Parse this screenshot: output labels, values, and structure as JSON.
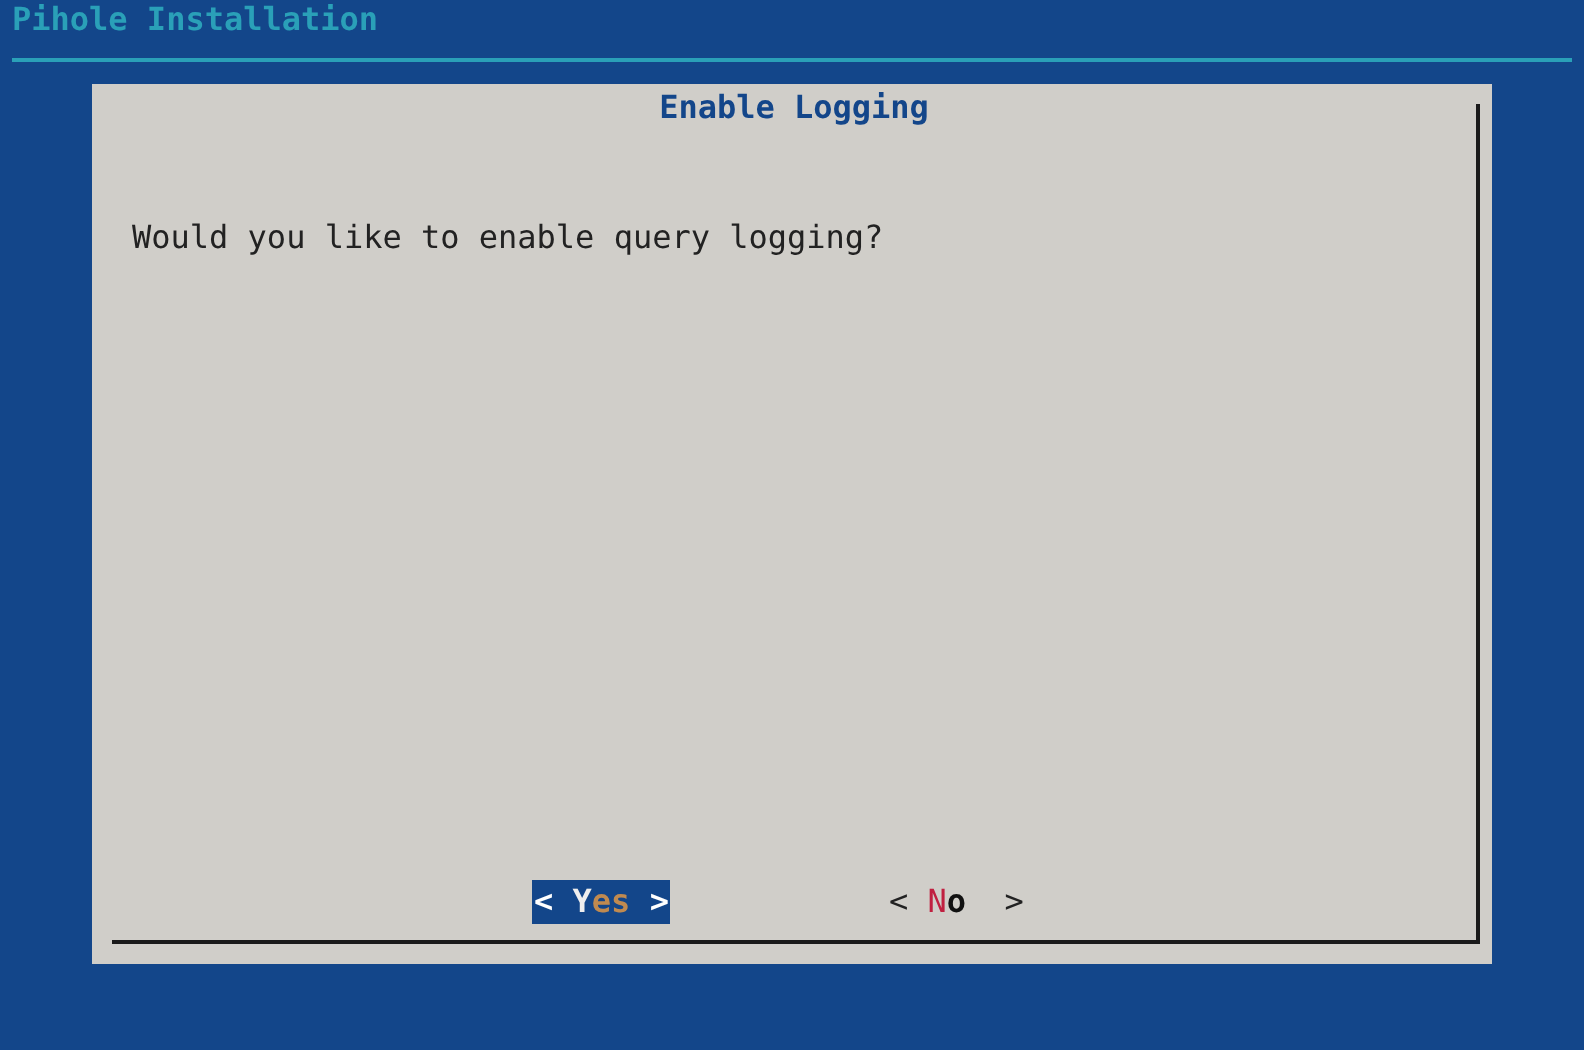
{
  "backtitle": "Pihole Installation",
  "dialog": {
    "title": "Enable Logging",
    "message": "Would you like to enable query logging?",
    "buttons": [
      {
        "open": "<",
        "label": "Yes",
        "close": ">",
        "selected": true
      },
      {
        "open": "<",
        "label": "No",
        "close": ">",
        "selected": false
      }
    ]
  }
}
